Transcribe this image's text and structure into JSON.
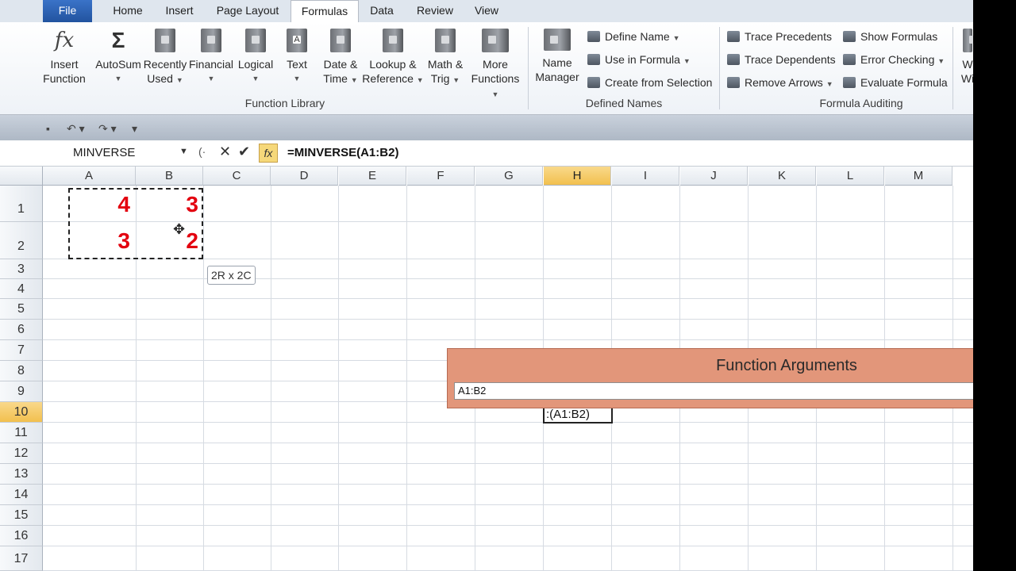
{
  "tabs": [
    "File",
    "Home",
    "Insert",
    "Page Layout",
    "Formulas",
    "Data",
    "Review",
    "View"
  ],
  "active_tab": "Formulas",
  "function_library": {
    "buttons": [
      {
        "line1": "Insert",
        "line2": "Function",
        "icon": "fx-icon"
      },
      {
        "line1": "AutoSum",
        "line2": "",
        "icon": "sigma-icon"
      },
      {
        "line1": "Recently",
        "line2": "Used",
        "icon": "book-icon"
      },
      {
        "line1": "Financial",
        "line2": "",
        "icon": "book-icon"
      },
      {
        "line1": "Logical",
        "line2": "",
        "icon": "book-icon"
      },
      {
        "line1": "Text",
        "line2": "",
        "icon": "book-text-icon"
      },
      {
        "line1": "Date &",
        "line2": "Time",
        "icon": "book-icon"
      },
      {
        "line1": "Lookup &",
        "line2": "Reference",
        "icon": "book-icon"
      },
      {
        "line1": "Math &",
        "line2": "Trig",
        "icon": "book-icon"
      },
      {
        "line1": "More",
        "line2": "Functions",
        "icon": "books-icon"
      }
    ],
    "label": "Function Library"
  },
  "defined_names": {
    "name_manager": {
      "line1": "Name",
      "line2": "Manager"
    },
    "commands": [
      "Define Name",
      "Use in Formula",
      "Create from Selection"
    ],
    "label": "Defined Names"
  },
  "formula_auditing": {
    "left": [
      "Trace Precedents",
      "Trace Dependents",
      "Remove Arrows"
    ],
    "right": [
      "Show Formulas",
      "Error Checking",
      "Evaluate Formula"
    ],
    "label": "Formula Auditing",
    "watch_line1": "W",
    "watch_line2": "Wi"
  },
  "name_box": "MINVERSE",
  "formula": "=MINVERSE(A1:B2)",
  "columns": [
    "A",
    "B",
    "C",
    "D",
    "E",
    "F",
    "G",
    "H",
    "I",
    "J",
    "K",
    "L",
    "M"
  ],
  "selected_column": "H",
  "rows": [
    "1",
    "2",
    "3",
    "4",
    "5",
    "6",
    "7",
    "8",
    "9",
    "10",
    "11",
    "12",
    "13",
    "14",
    "15",
    "16",
    "17"
  ],
  "selected_row": "10",
  "cells": {
    "A1": "4",
    "B1": "3",
    "A2": "3",
    "B2": "2"
  },
  "range_tooltip": "2R x 2C",
  "edit_cell_text": ":(A1:B2)",
  "dialog": {
    "title": "Function Arguments",
    "input_value": "A1:B2"
  },
  "colors": {
    "accent_tab": "#22539f",
    "cell_value": "#e3000f",
    "dialog_bg": "#e2967a",
    "selected_header": "#f2c04e"
  }
}
